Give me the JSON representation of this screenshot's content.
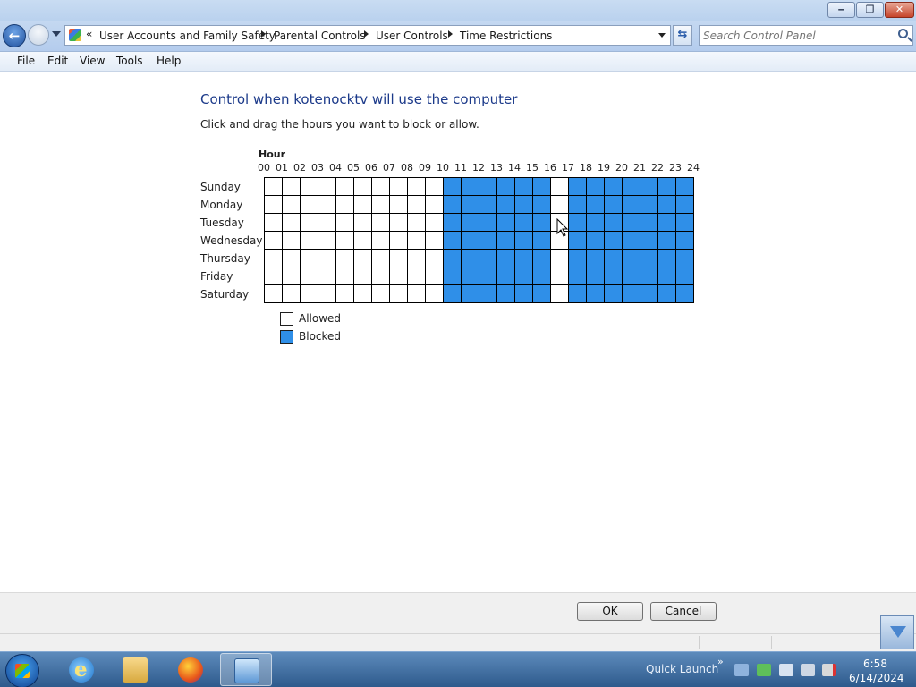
{
  "window": {
    "min_glyph": "‒",
    "max_glyph": "❐",
    "close_glyph": "✕"
  },
  "address": {
    "overflow": "«",
    "crumbs": [
      "User Accounts and Family Safety",
      "Parental Controls",
      "User Controls",
      "Time Restrictions"
    ]
  },
  "search": {
    "placeholder": "Search Control Panel"
  },
  "menu": [
    "File",
    "Edit",
    "View",
    "Tools",
    "Help"
  ],
  "page": {
    "heading": "Control when kotenocktv will use the computer",
    "instruction": "Click and drag the hours you want to block or allow.",
    "hour_label": "Hour",
    "hours": [
      "00",
      "01",
      "02",
      "03",
      "04",
      "05",
      "06",
      "07",
      "08",
      "09",
      "10",
      "11",
      "12",
      "13",
      "14",
      "15",
      "16",
      "17",
      "18",
      "19",
      "20",
      "21",
      "22",
      "23",
      "24"
    ],
    "days": [
      "Sunday",
      "Monday",
      "Tuesday",
      "Wednesday",
      "Thursday",
      "Friday",
      "Saturday"
    ],
    "blocked_hours": [
      10,
      11,
      12,
      13,
      14,
      15,
      17,
      18,
      19,
      20,
      21,
      22,
      23
    ],
    "legend": {
      "allowed": "Allowed",
      "blocked": "Blocked"
    }
  },
  "buttons": {
    "ok": "OK",
    "cancel": "Cancel"
  },
  "taskbar": {
    "quick_launch": "Quick Launch",
    "quick_launch_chevron": "»",
    "time": "6:58",
    "date": "6/14/2024"
  },
  "colors": {
    "blocked": "#2f8fe8",
    "allowed": "#ffffff",
    "heading": "#1c3a8a"
  }
}
